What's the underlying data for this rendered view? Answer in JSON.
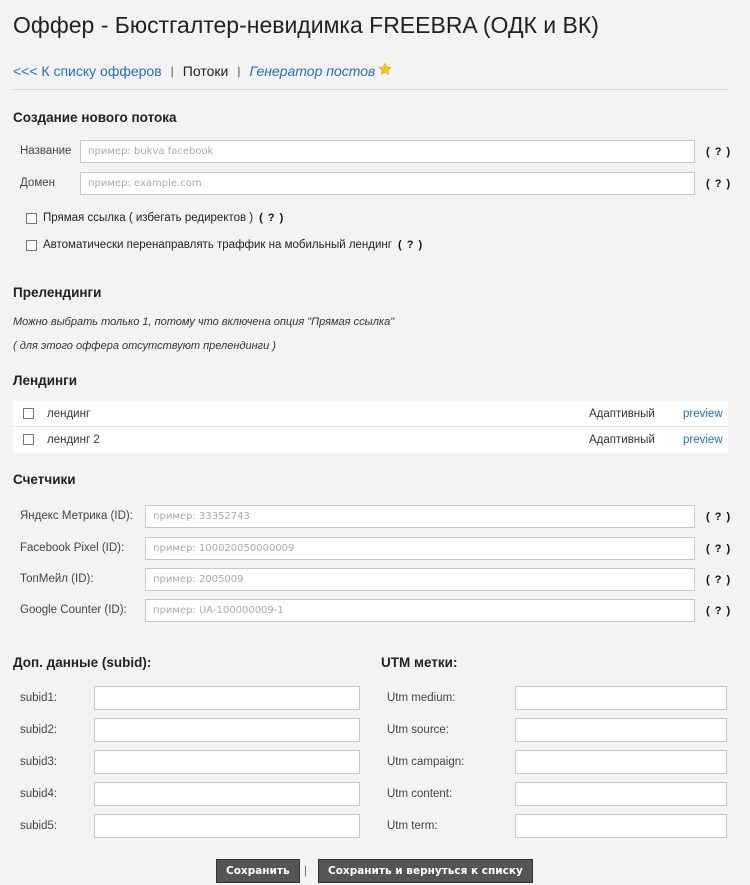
{
  "page": {
    "title": "Оффер - Бюстгалтер-невидимка FREEBRA (ОДК и ВК)"
  },
  "nav": {
    "back_link": "<<< К списку офферов",
    "separator": "|",
    "current": "Потоки",
    "generator_link": "Генератор постов",
    "star_icon": "star-icon"
  },
  "new_flow": {
    "heading": "Создание нового потока",
    "name_label": "Название",
    "name_placeholder": "пример: bukva facebook",
    "name_value": "",
    "domain_label": "Домен",
    "domain_placeholder": "пример: example.com",
    "domain_value": "",
    "help": "( ? )",
    "direct_link_label": "Прямая ссылка ( избегать редиректов )",
    "direct_link_checked": false,
    "auto_redirect_label": "Автоматически перенаправлять траффик на мобильный лендинг",
    "auto_redirect_checked": false
  },
  "prelandings": {
    "heading": "Прелендинги",
    "note1": "Можно выбрать только 1, потому что включена опция \"Прямая ссылка\"",
    "note2": "( для этого оффера отсутствуют прелендинги )"
  },
  "landings": {
    "heading": "Лендинги",
    "items": [
      {
        "name": "лендинг",
        "type": "Адаптивный",
        "preview": "preview",
        "checked": false
      },
      {
        "name": "лендинг 2",
        "type": "Адаптивный",
        "preview": "preview",
        "checked": false
      }
    ]
  },
  "counters": {
    "heading": "Счетчики",
    "help": "( ? )",
    "items": [
      {
        "label": "Яндекс Метрика (ID):",
        "placeholder": "пример: 33352743",
        "value": ""
      },
      {
        "label": "Facebook Pixel (ID):",
        "placeholder": "пример: 100020050000009",
        "value": ""
      },
      {
        "label": "ТопМейл (ID):",
        "placeholder": "пример: 2005009",
        "value": ""
      },
      {
        "label": "Google Counter (ID):",
        "placeholder": "пример: UA-100000009-1",
        "value": ""
      }
    ]
  },
  "subid": {
    "heading": "Доп. данные (subid):",
    "items": [
      {
        "label": "subid1:",
        "value": ""
      },
      {
        "label": "subid2:",
        "value": ""
      },
      {
        "label": "subid3:",
        "value": ""
      },
      {
        "label": "subid4:",
        "value": ""
      },
      {
        "label": "subid5:",
        "value": ""
      }
    ]
  },
  "utm": {
    "heading": "UTM метки:",
    "items": [
      {
        "label": "Utm medium:",
        "value": ""
      },
      {
        "label": "Utm source:",
        "value": ""
      },
      {
        "label": "Utm campaign:",
        "value": ""
      },
      {
        "label": "Utm content:",
        "value": ""
      },
      {
        "label": "Utm term:",
        "value": ""
      }
    ]
  },
  "actions": {
    "save": "Сохранить",
    "separator": "|",
    "save_and_return": "Сохранить и вернуться к списку"
  },
  "colors": {
    "link": "#2a6ebb",
    "button_bg": "#555555",
    "page_bg": "#f3f3f3",
    "star": "#f5c518"
  }
}
